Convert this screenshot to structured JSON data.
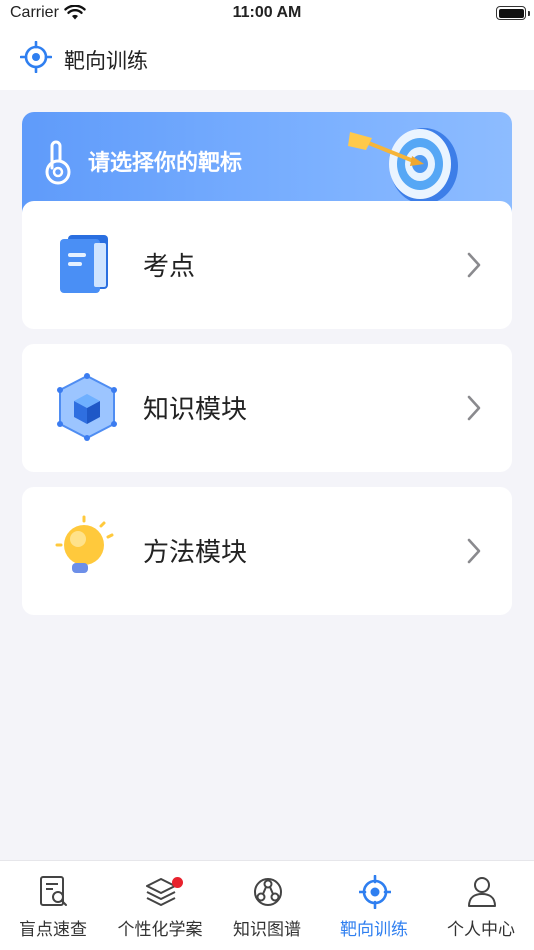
{
  "status_bar": {
    "carrier": "Carrier",
    "time": "11:00 AM"
  },
  "nav": {
    "title": "靶向训练",
    "icon": "target-icon"
  },
  "banner": {
    "text": "请选择你的靶标",
    "icon": "pointing-hand-icon",
    "illustration": "dart-target-icon"
  },
  "cards": [
    {
      "label": "考点",
      "icon": "notebook-icon"
    },
    {
      "label": "知识模块",
      "icon": "cube-icon"
    },
    {
      "label": "方法模块",
      "icon": "lightbulb-icon"
    }
  ],
  "tabs": [
    {
      "label": "盲点速查",
      "icon": "document-search-icon",
      "active": false
    },
    {
      "label": "个性化学案",
      "icon": "layers-icon",
      "active": false,
      "badge": true
    },
    {
      "label": "知识图谱",
      "icon": "graph-icon",
      "active": false
    },
    {
      "label": "靶向训练",
      "icon": "target-icon",
      "active": true
    },
    {
      "label": "个人中心",
      "icon": "user-icon",
      "active": false
    }
  ],
  "colors": {
    "accent": "#2f7ff0",
    "banner": "#6aa4fc",
    "badge": "#e8222d",
    "background": "#f4f4f9"
  }
}
